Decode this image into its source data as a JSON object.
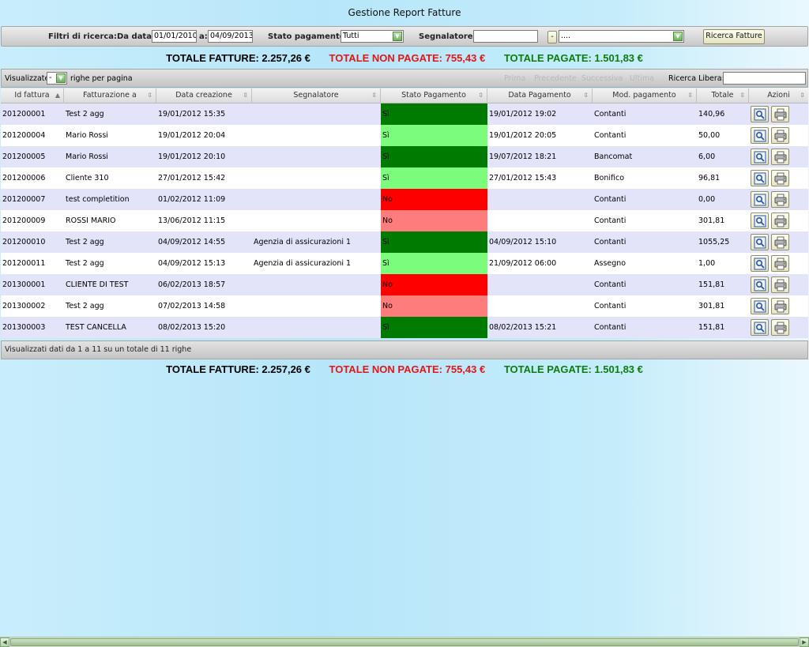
{
  "title": "Gestione Report Fatture",
  "filters": {
    "label": "Filtri di ricerca:",
    "from_label": "Da data:",
    "from_value": "01/01/2010",
    "to_label": "a:",
    "to_value": "04/09/2013",
    "status_label": "Stato pagamento:",
    "status_value": "Tutti",
    "reporter_label": "Segnalatore:",
    "reporter_value": "",
    "dash_button": "-",
    "reporter_select_value": "....",
    "search_button": "Ricerca Fatture"
  },
  "totals": {
    "all": "TOTALE FATTURE: 2.257,26 €",
    "unpaid": "TOTALE NON PAGATE: 755,43 €",
    "paid": "TOTALE PAGATE: 1.501,83 €"
  },
  "toolbar": {
    "show_label": "Visualizzate",
    "per_page_value": "-",
    "per_page_label": "righe per pagina",
    "first": "Prima",
    "prev": "Precedente",
    "next": "Successiva",
    "last": "Ultima",
    "search_label": "Ricerca Libera:"
  },
  "columns": [
    "Id fattura",
    "Fatturazione a",
    "Data creazione",
    "Segnalatore",
    "Stato Pagamento",
    "Data Pagamento",
    "Mod. pagamento",
    "Totale",
    "Azioni"
  ],
  "rows": [
    {
      "id": "201200001",
      "to": "Test 2 agg",
      "created": "19/01/2012 15:35",
      "reporter": "",
      "status": "Sì",
      "paid_date": "19/01/2012 19:02",
      "method": "Contanti",
      "total": "140,96"
    },
    {
      "id": "201200004",
      "to": "Mario Rossi",
      "created": "19/01/2012 20:04",
      "reporter": "",
      "status": "Sì",
      "paid_date": "19/01/2012 20:05",
      "method": "Contanti",
      "total": "50,00"
    },
    {
      "id": "201200005",
      "to": "Mario Rossi",
      "created": "19/01/2012 20:10",
      "reporter": "",
      "status": "Sì",
      "paid_date": "19/07/2012 18:21",
      "method": "Bancomat",
      "total": "6,00"
    },
    {
      "id": "201200006",
      "to": "Cliente 310",
      "created": "27/01/2012 15:42",
      "reporter": "",
      "status": "Sì",
      "paid_date": "27/01/2012 15:43",
      "method": "Bonifico",
      "total": "96,81"
    },
    {
      "id": "201200007",
      "to": "test completition",
      "created": "01/02/2012 11:09",
      "reporter": "",
      "status": "No",
      "paid_date": "",
      "method": "Contanti",
      "total": "0,00"
    },
    {
      "id": "201200009",
      "to": "ROSSI MARIO",
      "created": "13/06/2012 11:15",
      "reporter": "",
      "status": "No",
      "paid_date": "",
      "method": "Contanti",
      "total": "301,81"
    },
    {
      "id": "201200010",
      "to": "Test 2 agg",
      "created": "04/09/2012 14:55",
      "reporter": "Agenzia di assicurazioni 1",
      "status": "Sì",
      "paid_date": "04/09/2012 15:10",
      "method": "Contanti",
      "total": "1055,25"
    },
    {
      "id": "201200011",
      "to": "Test 2 agg",
      "created": "04/09/2012 15:13",
      "reporter": "Agenzia di assicurazioni 1",
      "status": "Sì",
      "paid_date": "21/09/2012 06:00",
      "method": "Assegno",
      "total": "1,00"
    },
    {
      "id": "201300001",
      "to": "CLIENTE DI TEST",
      "created": "06/02/2013 18:57",
      "reporter": "",
      "status": "No",
      "paid_date": "",
      "method": "Contanti",
      "total": "151,81"
    },
    {
      "id": "201300002",
      "to": "Test 2 agg",
      "created": "07/02/2013 14:58",
      "reporter": "",
      "status": "No",
      "paid_date": "",
      "method": "Contanti",
      "total": "301,81"
    },
    {
      "id": "201300003",
      "to": "TEST CANCELLA",
      "created": "08/02/2013 15:20",
      "reporter": "",
      "status": "Sì",
      "paid_date": "08/02/2013 15:21",
      "method": "Contanti",
      "total": "151,81"
    }
  ],
  "status_colors": {
    "paid_odd": "#007a00",
    "paid_even": "#7cfc7c",
    "unpaid_odd": "#ff0000",
    "unpaid_even": "#ff7c7c"
  },
  "footer": "Visualizzati dati da 1 a 11 su un totale di 11 righe",
  "action_icons": [
    "magnifier-icon",
    "printer-icon"
  ]
}
